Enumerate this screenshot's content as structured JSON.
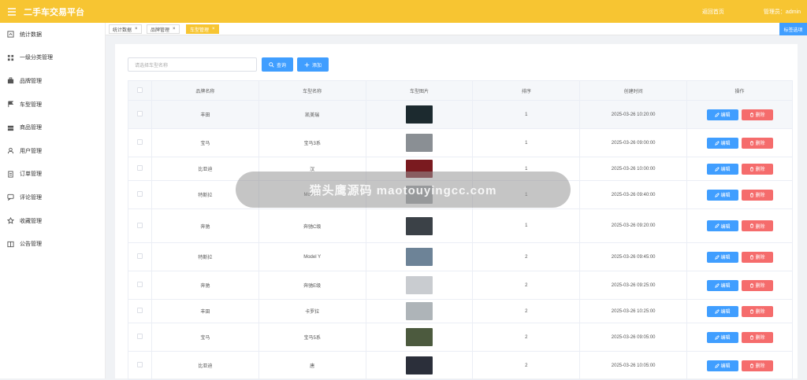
{
  "header": {
    "title": "二手车交易平台",
    "back_home": "返回首页",
    "user": "管理员：admin"
  },
  "sidebar": {
    "items": [
      {
        "label": "统计数据",
        "icon": "chart-icon"
      },
      {
        "label": "一级分类管理",
        "icon": "grid-icon"
      },
      {
        "label": "品牌管理",
        "icon": "briefcase-icon"
      },
      {
        "label": "车型管理",
        "icon": "flag-icon"
      },
      {
        "label": "商品管理",
        "icon": "goods-icon"
      },
      {
        "label": "用户管理",
        "icon": "user-icon"
      },
      {
        "label": "订单管理",
        "icon": "document-icon"
      },
      {
        "label": "评论管理",
        "icon": "comment-icon"
      },
      {
        "label": "收藏管理",
        "icon": "star-icon"
      },
      {
        "label": "公告管理",
        "icon": "book-icon"
      }
    ]
  },
  "tabs": [
    {
      "label": "统计数据",
      "close": "×"
    },
    {
      "label": "品牌管理",
      "close": "×"
    },
    {
      "label": "车型管理",
      "close": "×"
    }
  ],
  "tab_options": "标签选项",
  "search": {
    "placeholder": "请选择车型名称",
    "query_label": "查询",
    "add_label": "添加"
  },
  "table": {
    "headers": [
      "品牌名称",
      "车型名称",
      "车型图片",
      "排序",
      "创建时间",
      "操作"
    ],
    "edit_label": "编辑",
    "delete_label": "删除",
    "rows": [
      {
        "brand": "丰田",
        "model": "凯美瑞",
        "sort": "1",
        "created": "2025-03-26 10:20:00",
        "img": "#1c2a2f"
      },
      {
        "brand": "宝马",
        "model": "宝马3系",
        "sort": "1",
        "created": "2025-03-26 09:00:00",
        "img": "#8a8f94"
      },
      {
        "brand": "比亚迪",
        "model": "汉",
        "sort": "1",
        "created": "2025-03-26 10:00:00",
        "img": "#7a1a1f"
      },
      {
        "brand": "特斯拉",
        "model": "Model 3",
        "sort": "1",
        "created": "2025-03-26 09:40:00",
        "img": "#9a9ea2"
      },
      {
        "brand": "奔驰",
        "model": "奔驰C级",
        "sort": "1",
        "created": "2025-03-26 09:20:00",
        "img": "#3b4147"
      },
      {
        "brand": "特斯拉",
        "model": "Model Y",
        "sort": "2",
        "created": "2025-03-26 09:45:00",
        "img": "#6d8397"
      },
      {
        "brand": "奔驰",
        "model": "奔驰E级",
        "sort": "2",
        "created": "2025-03-26 09:25:00",
        "img": "#c9ccd0"
      },
      {
        "brand": "丰田",
        "model": "卡罗拉",
        "sort": "2",
        "created": "2025-03-26 10:25:00",
        "img": "#aeb4b8"
      },
      {
        "brand": "宝马",
        "model": "宝马5系",
        "sort": "2",
        "created": "2025-03-26 09:05:00",
        "img": "#4c5a3e"
      },
      {
        "brand": "比亚迪",
        "model": "唐",
        "sort": "2",
        "created": "2025-03-26 10:05:00",
        "img": "#2b2f3a"
      }
    ]
  },
  "overlay_text": "猫头鹰源码 maotouyingcc.com",
  "colors": {
    "primary": "#409eff",
    "danger": "#f56c6c",
    "brand_bar": "#f7c532"
  }
}
